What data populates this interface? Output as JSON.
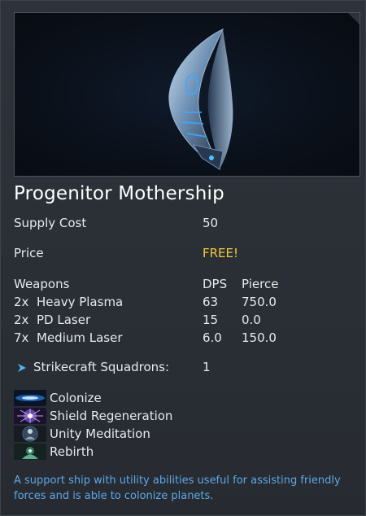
{
  "ship": {
    "name": "Progenitor Mothership",
    "preview_icon": "mothership-render-image"
  },
  "stats": {
    "supply_cost_label": "Supply Cost",
    "supply_cost_value": "50",
    "price_label": "Price",
    "price_value": "FREE!"
  },
  "weapons": {
    "label": "Weapons",
    "dps_header": "DPS",
    "pierce_header": "Pierce",
    "rows": [
      {
        "count": "2x",
        "name": "Heavy Plasma",
        "dps": "63",
        "pierce": "750.0"
      },
      {
        "count": "2x",
        "name": "PD Laser",
        "dps": "15",
        "pierce": "0.0"
      },
      {
        "count": "7x",
        "name": "Medium Laser",
        "dps": "6.0",
        "pierce": "150.0"
      }
    ]
  },
  "strikecraft": {
    "icon": "strikecraft-icon",
    "label": "Strikecraft Squadrons:",
    "value": "1"
  },
  "abilities": [
    {
      "icon": "colonize-icon",
      "label": "Colonize"
    },
    {
      "icon": "shield-regeneration-icon",
      "label": "Shield Regeneration"
    },
    {
      "icon": "unity-meditation-icon",
      "label": "Unity Meditation"
    },
    {
      "icon": "rebirth-icon",
      "label": "Rebirth"
    }
  ],
  "description": "A support ship with utility abilities useful for assisting friendly forces and is able to colonize planets.",
  "colors": {
    "price": "#f2c83f",
    "description": "#5ea8e8",
    "strikecraft_icon": "#4fb6f0"
  }
}
